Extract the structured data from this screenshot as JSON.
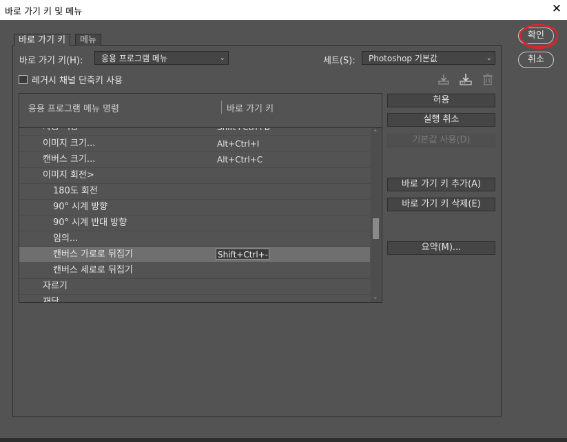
{
  "window": {
    "title": "바로 가기 키 및 메뉴",
    "close": "✕"
  },
  "tabs": [
    {
      "label": "바로 가기 키"
    },
    {
      "label": "메뉴"
    }
  ],
  "shortcut_for": {
    "label": "바로 가기 키(H):",
    "value": "응용 프로그램 메뉴"
  },
  "set": {
    "label": "세트(S):",
    "value": "Photoshop 기본값"
  },
  "legacy_channel": {
    "label": "레거시 채널 단축키 사용",
    "checked": false
  },
  "toolbar_icons": [
    "save-set-icon",
    "save-as-set-icon",
    "delete-set-icon"
  ],
  "table": {
    "col_command": "응용 프로그램 메뉴 명령",
    "col_shortcut": "바로 가기 키",
    "rows": [
      {
        "command": "자동 색상",
        "shortcut": "Shift+Ctrl+B"
      },
      {
        "command": "이미지 크기...",
        "shortcut": "Alt+Ctrl+I"
      },
      {
        "command": "캔버스 크기...",
        "shortcut": "Alt+Ctrl+C"
      },
      {
        "command": "이미지 회전>",
        "shortcut": ""
      },
      {
        "command": "180도 회전",
        "shortcut": ""
      },
      {
        "command": "90° 시계 방향",
        "shortcut": ""
      },
      {
        "command": "90° 시계 반대 방향",
        "shortcut": ""
      },
      {
        "command": "임의...",
        "shortcut": ""
      },
      {
        "command": "캔버스 가로로 뒤집기",
        "shortcut": "Shift+Ctrl+-"
      },
      {
        "command": "캔버스 세로로 뒤집기",
        "shortcut": ""
      },
      {
        "command": "자르기",
        "shortcut": ""
      },
      {
        "command": "재단",
        "shortcut": ""
      }
    ]
  },
  "buttons": {
    "accept": "허용",
    "undo": "실행 취소",
    "use_default": "기본값 사용(D)",
    "add_shortcut": "바로 가기 키 추가(A)",
    "delete_shortcut": "바로 가기 키 삭제(E)",
    "summary": "요약(M)..."
  },
  "dialog": {
    "ok": "확인",
    "cancel": "취소"
  },
  "colors": {
    "annotation": "#e0242b",
    "background": "#535353",
    "selected_row": "#6f6f6f"
  }
}
